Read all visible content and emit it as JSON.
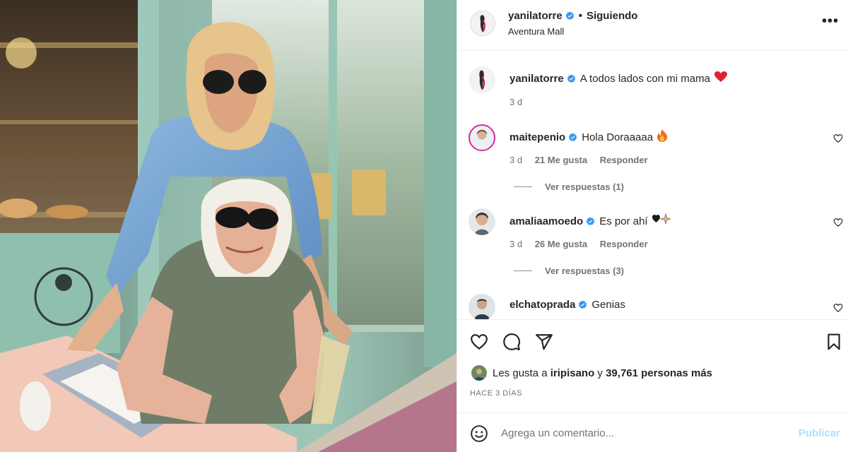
{
  "post": {
    "username": "yanilatorre",
    "follow_status": "Siguiendo",
    "dot": "•",
    "location": "Aventura Mall",
    "more": "•••"
  },
  "comments": [
    {
      "user": "yanilatorre",
      "text": "A todos lados con mi mama",
      "emoji": "red-heart",
      "time": "3 d"
    },
    {
      "user": "maitepenio",
      "text": "Hola Doraaaaa",
      "emoji": "fire",
      "time": "3 d",
      "likes": "21 Me gusta",
      "reply": "Responder",
      "view_replies": "Ver respuestas (1)"
    },
    {
      "user": "amaliaamoedo",
      "text": "Es por ahí",
      "emoji": "heart-sparkles",
      "time": "3 d",
      "likes": "26 Me gusta",
      "reply": "Responder",
      "view_replies": "Ver respuestas (3)"
    },
    {
      "user": "elchatoprada",
      "text": "Genias"
    }
  ],
  "likes_summary": {
    "prefix": "Les gusta a",
    "user": "iripisano",
    "connector": "y",
    "count": "39,761 personas más"
  },
  "posted_ago": "HACE 3 DÍAS",
  "add_comment": {
    "placeholder": "Agrega un comentario...",
    "publish": "Publicar"
  },
  "colors": {
    "verified": "#3897f0",
    "publish_disabled": "#b2dffc",
    "heart": "#ed4956"
  }
}
